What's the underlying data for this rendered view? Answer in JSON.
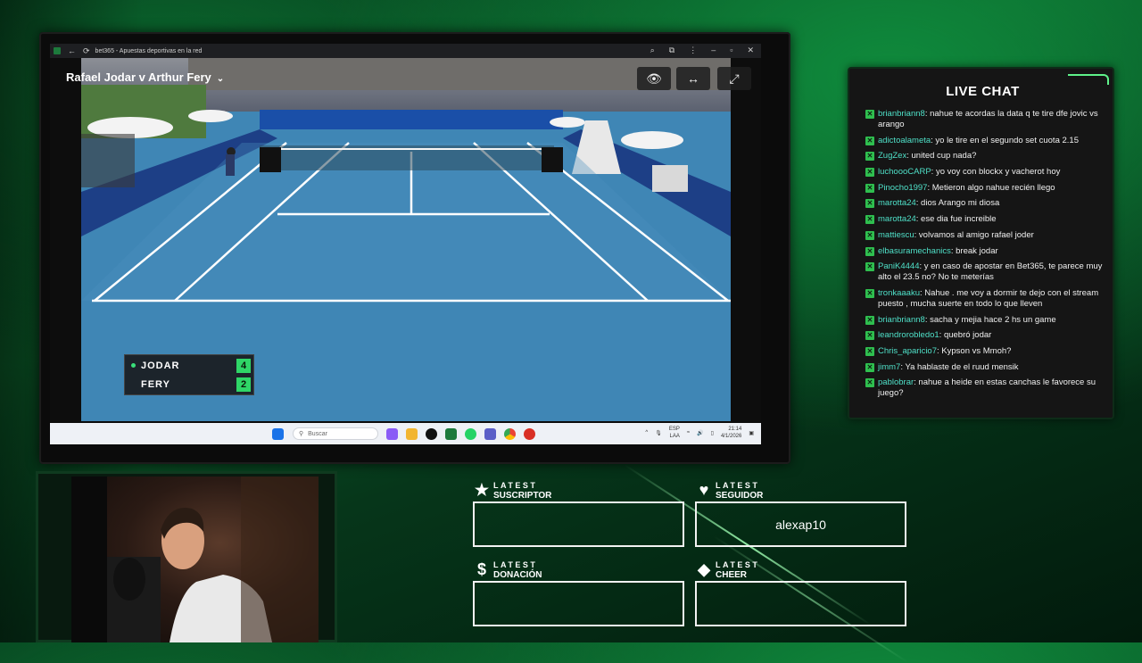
{
  "browser": {
    "title": "bet365 - Apuestas deportivas en la red",
    "match_title": "Rafael Jodar v Arthur Fery"
  },
  "scoreboard": {
    "players": [
      {
        "name": "JODAR",
        "score": "4",
        "serving": true
      },
      {
        "name": "FERY",
        "score": "2",
        "serving": false
      }
    ]
  },
  "taskbar": {
    "search_placeholder": "Buscar",
    "lang_top": "ESP",
    "lang_bottom": "LAA",
    "time": "21:14",
    "date": "4/1/2026"
  },
  "chat": {
    "title": "LIVE CHAT",
    "messages": [
      {
        "user": "brianbriann8",
        "text": ": nahue te acordas la data q te tire dfe jovic vs arango"
      },
      {
        "user": "adictoalameta",
        "text": ": yo le tire en el segundo set cuota 2.15"
      },
      {
        "user": "ZugZex",
        "text": ": united cup nada?"
      },
      {
        "user": "luchoooCARP",
        "text": ": yo voy con blockx y vacherot hoy"
      },
      {
        "user": "Pinocho1997",
        "text": ": Metieron algo nahue recién llego"
      },
      {
        "user": "marotta24",
        "text": ": dios Arango mi diosa"
      },
      {
        "user": "marotta24",
        "text": ": ese dia fue increible"
      },
      {
        "user": "mattiescu",
        "text": ": volvamos al amigo rafael joder"
      },
      {
        "user": "elbasuramechanics",
        "text": ": break jodar"
      },
      {
        "user": "PaniK4444",
        "text": ": y en caso de apostar en Bet365, te parece muy alto el 23.5 no? No te meterías"
      },
      {
        "user": "tronkaaaku",
        "text": ": Nahue . me voy a dormir te dejo con el stream puesto , mucha suerte en todo lo que lleven"
      },
      {
        "user": "brianbriann8",
        "text": ": sacha y mejia hace 2 hs un game"
      },
      {
        "user": "leandrorobledo1",
        "text": ": quebró jodar"
      },
      {
        "user": "Chris_aparicio7",
        "text": ": Kypson vs Mmoh?"
      },
      {
        "user": "jimm7",
        "text": ": Ya hablaste de el ruud mensik"
      },
      {
        "user": "pablobrar",
        "text": ": nahue a heide en estas canchas le favorece su juego?"
      }
    ]
  },
  "alerts": {
    "latest_small": "LATEST",
    "subscriber": {
      "label": "SUSCRIPTOR",
      "value": ""
    },
    "follower": {
      "label": "SEGUIDOR",
      "value": "alexap10"
    },
    "donation": {
      "label": "DONACIÓN",
      "value": ""
    },
    "cheer": {
      "label": "CHEER",
      "value": ""
    }
  },
  "colors": {
    "accent_green": "#2fd667",
    "chat_username": "#4fe0c8",
    "court_blue": "#3f86b5"
  }
}
